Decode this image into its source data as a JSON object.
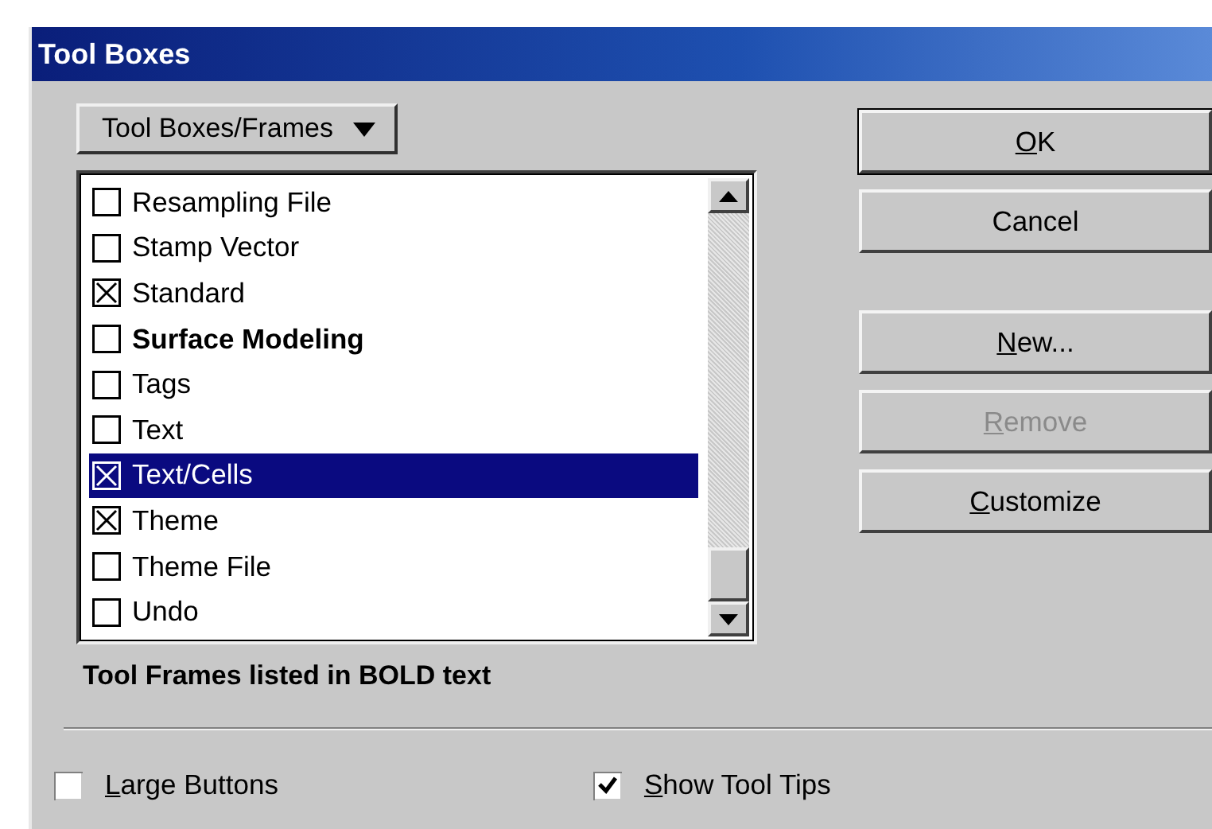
{
  "window": {
    "title": "Tool Boxes"
  },
  "dropdown": {
    "label": "Tool Boxes/Frames"
  },
  "list": [
    {
      "label": "Resampling File",
      "checked": false,
      "bold": false,
      "selected": false
    },
    {
      "label": "Stamp Vector",
      "checked": false,
      "bold": false,
      "selected": false
    },
    {
      "label": "Standard",
      "checked": true,
      "bold": false,
      "selected": false
    },
    {
      "label": "Surface Modeling",
      "checked": false,
      "bold": true,
      "selected": false
    },
    {
      "label": "Tags",
      "checked": false,
      "bold": false,
      "selected": false
    },
    {
      "label": "Text",
      "checked": false,
      "bold": false,
      "selected": false
    },
    {
      "label": "Text/Cells",
      "checked": true,
      "bold": false,
      "selected": true
    },
    {
      "label": "Theme",
      "checked": true,
      "bold": false,
      "selected": false
    },
    {
      "label": "Theme File",
      "checked": false,
      "bold": false,
      "selected": false
    },
    {
      "label": "Undo",
      "checked": false,
      "bold": false,
      "selected": false
    }
  ],
  "note": "Tool Frames listed in BOLD text",
  "button_groups": [
    [
      {
        "label": "OK",
        "default": true,
        "disabled": false,
        "underline_first": true
      },
      {
        "label": "Cancel",
        "default": false,
        "disabled": false,
        "underline_first": false
      }
    ],
    [
      {
        "label": "New...",
        "default": false,
        "disabled": false,
        "underline_first": true
      },
      {
        "label": "Remove",
        "default": false,
        "disabled": true,
        "underline_first": true
      },
      {
        "label": "Customize",
        "default": false,
        "disabled": false,
        "underline_first": true
      }
    ]
  ],
  "options": [
    {
      "label": "Large Buttons",
      "checked": false,
      "underline_first": true
    },
    {
      "label": "Show Tool Tips",
      "checked": true,
      "underline_first": true
    }
  ]
}
